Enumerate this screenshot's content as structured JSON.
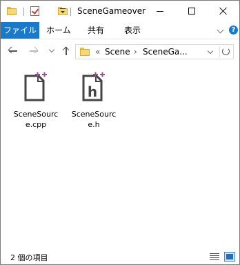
{
  "window": {
    "title": "SceneGameover"
  },
  "title_controls": {
    "minimize_icon": "minimize-icon",
    "maximize_icon": "maximize-icon",
    "close_icon": "close-icon"
  },
  "ribbon": {
    "tabs": [
      {
        "label": "ファイル",
        "active": true
      },
      {
        "label": "ホーム"
      },
      {
        "label": "共有"
      },
      {
        "label": "表示"
      }
    ],
    "accent_color": "#1979ca",
    "help_glyph": "?"
  },
  "navigation": {
    "path_prefix": "«",
    "breadcrumbs": [
      "Scene",
      "SceneGa..."
    ],
    "separator": "›"
  },
  "files": [
    {
      "name": "SceneSource.cpp",
      "display": "SceneSourc e.cpp",
      "icon": "cpp-file-icon",
      "icon_letter": ""
    },
    {
      "name": "SceneSource.h",
      "display": "SceneSourc e.h",
      "icon": "h-file-icon",
      "icon_letter": "h"
    }
  ],
  "icon_accent_color": "#9b4f96",
  "status": {
    "item_count": "2 個の項目"
  }
}
